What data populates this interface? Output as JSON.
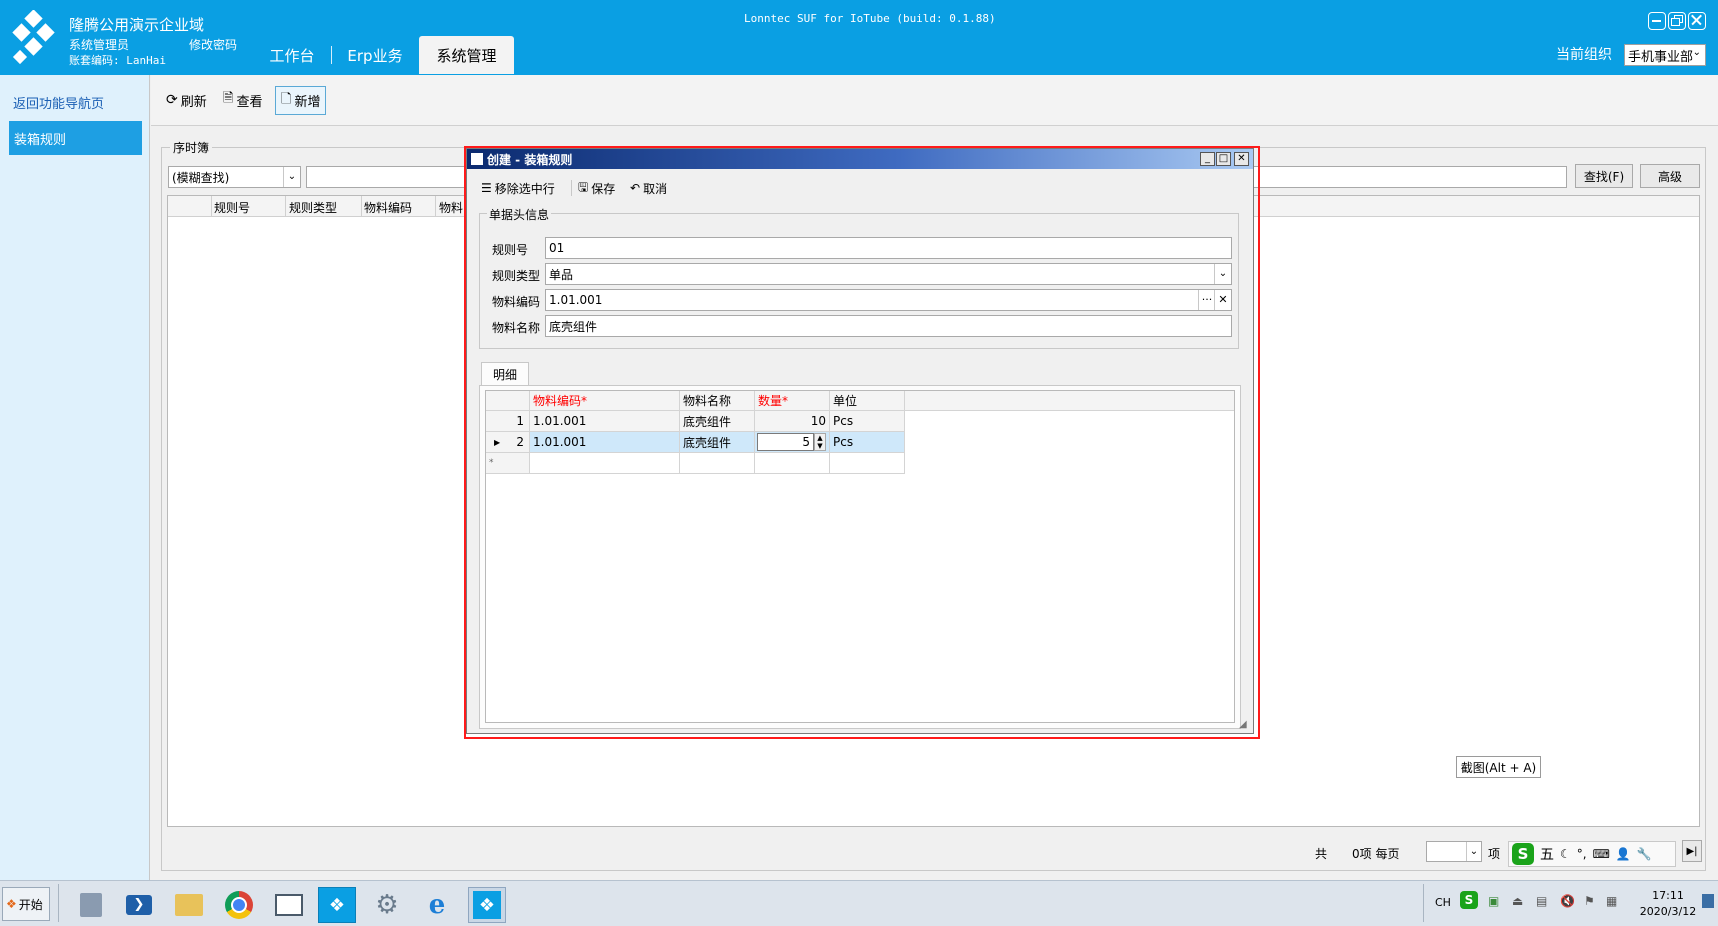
{
  "app": {
    "title": "隆腾公用演示企业域",
    "user_role": "系统管理员",
    "change_password": "修改密码",
    "account_code": "账套编码: LanHai",
    "window_caption": "Lonntec SUF for IoTube (build: 0.1.88)",
    "tabs": [
      {
        "label": "工作台",
        "active": false
      },
      {
        "label": "Erp业务",
        "active": false
      },
      {
        "label": "系统管理",
        "active": true
      }
    ],
    "org_label": "当前组织",
    "org_value": "手机事业部"
  },
  "sidebar": {
    "back_link": "返回功能导航页",
    "items": [
      {
        "label": "装箱规则",
        "active": true
      }
    ]
  },
  "toolbar": {
    "refresh": "刷新",
    "view": "查看",
    "add": "新增"
  },
  "list_panel": {
    "group_title": "序时簿",
    "search_mode": "(模糊查找)",
    "search_placeholder": "",
    "find_button": "查找(F)",
    "advanced_button": "高级",
    "columns": [
      "规则号",
      "规则类型",
      "物料编码",
      "物料"
    ]
  },
  "dialog": {
    "title": "创建 - 装箱规则",
    "toolbar": {
      "remove_row": "移除选中行",
      "save": "保存",
      "cancel": "取消"
    },
    "header_group": "单据头信息",
    "fields": {
      "rule_no": {
        "label": "规则号",
        "value": "01"
      },
      "rule_type": {
        "label": "规则类型",
        "value": "单品"
      },
      "material_code": {
        "label": "物料编码",
        "value": "1.01.001"
      },
      "material_name": {
        "label": "物料名称",
        "value": "底壳组件"
      }
    },
    "detail_tab": "明细",
    "grid": {
      "columns": [
        {
          "label": "物料编码*",
          "required": true
        },
        {
          "label": "物料名称",
          "required": false
        },
        {
          "label": "数量*",
          "required": true
        },
        {
          "label": "单位",
          "required": false
        }
      ],
      "rows": [
        {
          "no": "1",
          "code": "1.01.001",
          "name": "底壳组件",
          "qty": "10",
          "unit": "Pcs"
        },
        {
          "no": "2",
          "code": "1.01.001",
          "name": "底壳组件",
          "qty": "5",
          "unit": "Pcs"
        }
      ],
      "new_row_marker": "*"
    }
  },
  "screenshot_hint": "截图(Alt + A)",
  "pager": {
    "total_label": "共",
    "items_label": "0项 每页",
    "per_page_value": "",
    "unit": "项"
  },
  "ime": {
    "mode": "五"
  },
  "taskbar": {
    "start": "开始",
    "lang": "CH",
    "time": "17:11",
    "date": "2020/3/12"
  },
  "colors": {
    "header": "#0a9fe3",
    "highlight_outline": "#ff1a1a",
    "required_text": "#ff0000"
  }
}
